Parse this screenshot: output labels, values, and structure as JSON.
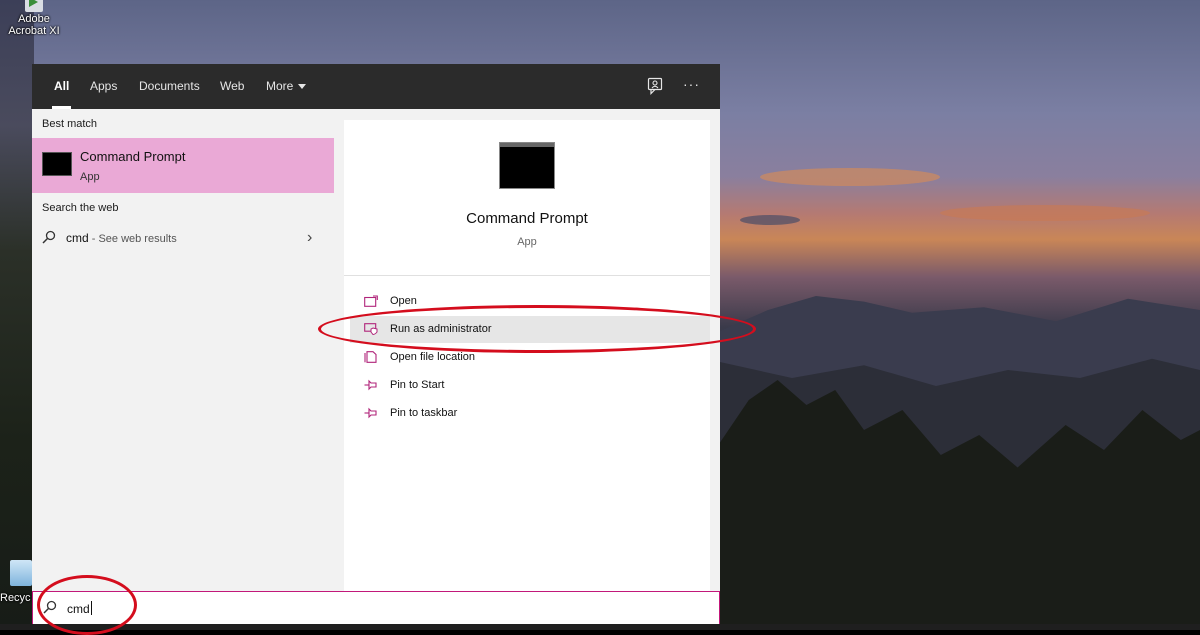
{
  "desktop": {
    "icons": [
      {
        "label": "Adobe Acrobat XI",
        "line1": "Adobe",
        "line2": "Acrobat XI"
      },
      {
        "label": "Recyc",
        "line1": "Recyc"
      }
    ]
  },
  "start_menu": {
    "tabs": [
      {
        "label": "All",
        "active": true
      },
      {
        "label": "Apps"
      },
      {
        "label": "Documents"
      },
      {
        "label": "Web"
      },
      {
        "label": "More"
      }
    ],
    "more_options_glyph": "···",
    "best_match": {
      "section_label": "Best match",
      "title": "Command Prompt",
      "subtitle": "App"
    },
    "web": {
      "section_label": "Search the web",
      "query": "cmd",
      "hint": " - See web results"
    },
    "detail": {
      "title": "Command Prompt",
      "subtitle": "App",
      "actions": [
        {
          "label": "Open",
          "icon": "open-icon"
        },
        {
          "label": "Run as administrator",
          "icon": "run-as-admin-icon"
        },
        {
          "label": "Open file location",
          "icon": "file-location-icon"
        },
        {
          "label": "Pin to Start",
          "icon": "pin-icon"
        },
        {
          "label": "Pin to taskbar",
          "icon": "pin-icon"
        }
      ]
    },
    "search": {
      "value": "cmd"
    }
  },
  "colors": {
    "highlight": "#eaa9d6",
    "accent": "#c2187a",
    "annotation": "#d40d1d",
    "header": "#2b2b2b"
  }
}
